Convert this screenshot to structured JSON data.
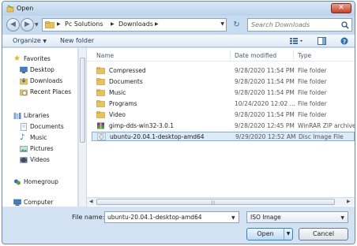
{
  "window": {
    "title": "Open"
  },
  "address": {
    "segments": [
      "Pc Solutions",
      "Downloads"
    ]
  },
  "search": {
    "placeholder": "Search Downloads"
  },
  "toolbar": {
    "organize": "Organize",
    "new_folder": "New folder"
  },
  "nav": {
    "favorites": "Favorites",
    "favorites_items": [
      "Desktop",
      "Downloads",
      "Recent Places"
    ],
    "libraries": "Libraries",
    "libraries_items": [
      "Documents",
      "Music",
      "Pictures",
      "Videos"
    ],
    "homegroup": "Homegroup",
    "computer": "Computer"
  },
  "columns": {
    "name": "Name",
    "date": "Date modified",
    "type": "Type"
  },
  "files": [
    {
      "name": "Compressed",
      "date": "9/28/2020 11:54 PM",
      "type": "File folder",
      "icon": "folder-icon"
    },
    {
      "name": "Documents",
      "date": "9/28/2020 11:54 PM",
      "type": "File folder",
      "icon": "folder-icon"
    },
    {
      "name": "Music",
      "date": "9/28/2020 11:54 PM",
      "type": "File folder",
      "icon": "folder-icon"
    },
    {
      "name": "Programs",
      "date": "10/24/2020 12:02 ...",
      "type": "File folder",
      "icon": "folder-icon"
    },
    {
      "name": "Video",
      "date": "9/28/2020 11:54 PM",
      "type": "File folder",
      "icon": "folder-icon"
    },
    {
      "name": "gimp-dds-win32-3.0.1",
      "date": "9/28/2020 12:45 PM",
      "type": "WinRAR ZIP archive",
      "icon": "winrar-archive-icon"
    },
    {
      "name": "ubuntu-20.04.1-desktop-amd64",
      "date": "9/29/2020 12:52 AM",
      "type": "Disc Image File",
      "icon": "disc-image-icon",
      "selected": true
    }
  ],
  "footer": {
    "file_name_label": "File name:",
    "file_name_value": "ubuntu-20.04.1-desktop-amd64",
    "file_type": "ISO Image",
    "open_label": "Open",
    "cancel_label": "Cancel"
  },
  "colors": {
    "selection": "#dcebfa",
    "folder": "#e8c25a",
    "frame": "#c8dcef"
  }
}
